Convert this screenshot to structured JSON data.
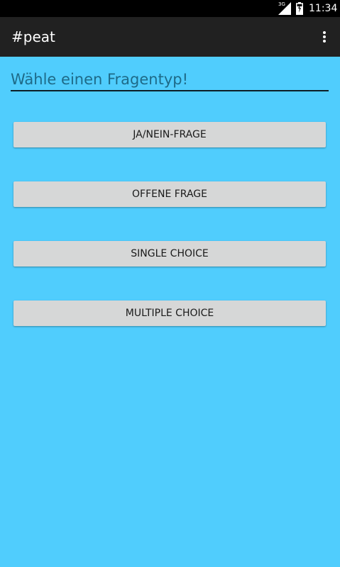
{
  "status_bar": {
    "network": "3G",
    "time": "11:34",
    "icons": [
      "signal-icon",
      "battery-icon"
    ]
  },
  "app_bar": {
    "title": "#peat",
    "overflow_icon": "more-vert-icon"
  },
  "main": {
    "input": {
      "value": "",
      "placeholder": "Wähle einen Fragentyp!"
    },
    "buttons": [
      {
        "label": "JA/NEIN-FRAGE"
      },
      {
        "label": "OFFENE FRAGE"
      },
      {
        "label": "SINGLE CHOICE"
      },
      {
        "label": "MULTIPLE CHOICE"
      }
    ]
  },
  "colors": {
    "background": "#50cdfd",
    "app_bar": "#212121",
    "status_bar": "#000000",
    "button": "#d6d7d7"
  }
}
